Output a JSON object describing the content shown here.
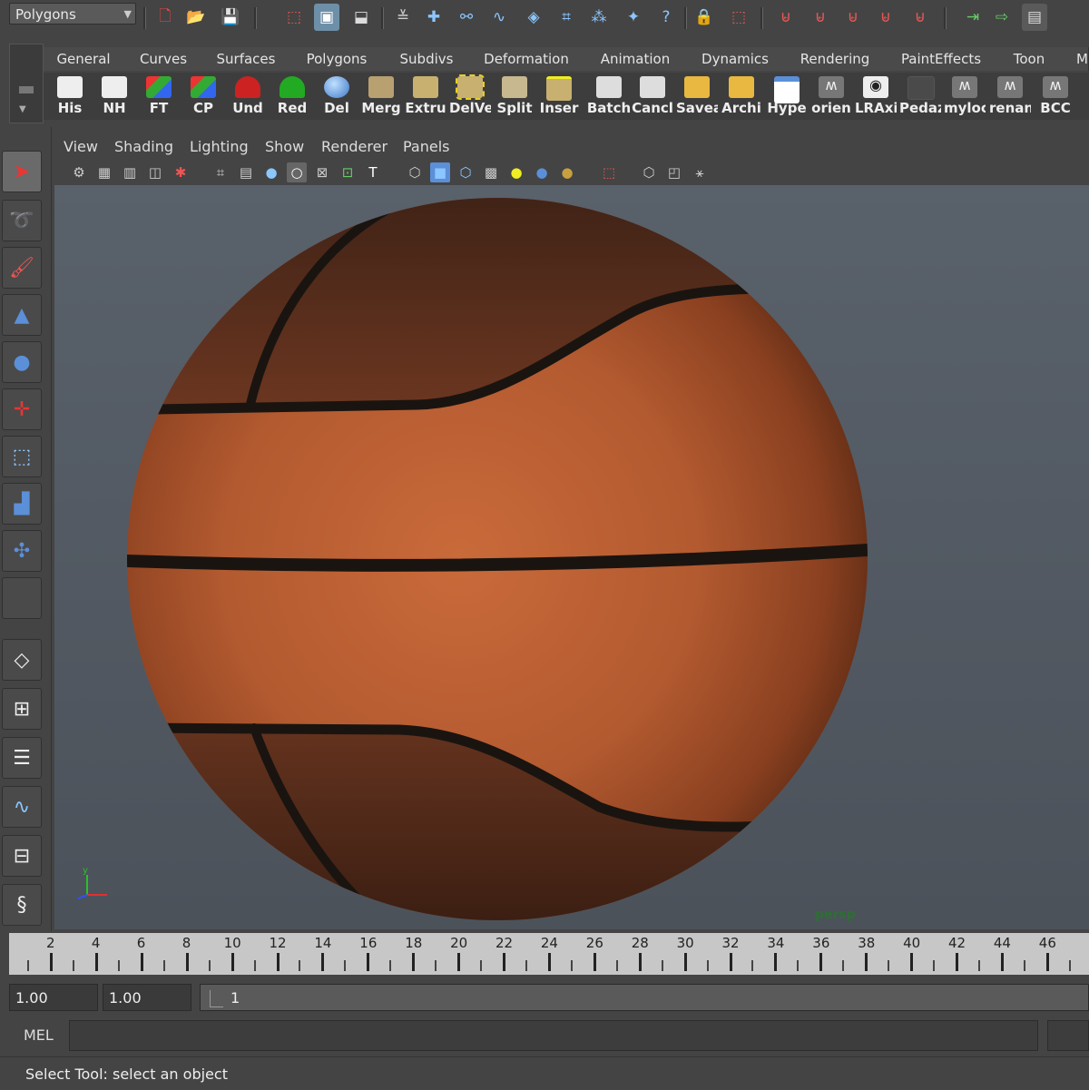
{
  "status_line": {
    "mode_selector": "Polygons",
    "icons": [
      "new-scene-icon",
      "open-scene-icon",
      "save-scene-icon",
      "select-by-hierarchy-icon",
      "select-by-object-icon",
      "select-by-component-icon",
      "mask-icon",
      "snap-grid-icon",
      "snap-curve-icon",
      "snap-point-icon",
      "snap-view-plane-icon",
      "make-live-icon",
      "history-icon",
      "snap-pivot-icon",
      "help-icon",
      "lock-icon",
      "selection-mask-icon",
      "magnet-icon",
      "magnet-icon",
      "magnet-icon",
      "magnet-icon",
      "magnet-icon",
      "render-icon",
      "ipr-render-icon",
      "attribute-editor-icon"
    ]
  },
  "shelf": {
    "tabs": [
      "General",
      "Curves",
      "Surfaces",
      "Polygons",
      "Subdivs",
      "Deformation",
      "Animation",
      "Dynamics",
      "Rendering",
      "PaintEffects",
      "Toon",
      "M"
    ],
    "buttons": [
      {
        "label": "His",
        "icon": "pencil-icon"
      },
      {
        "label": "NH",
        "icon": "pencil-icon"
      },
      {
        "label": "FT",
        "icon": "axes-icon"
      },
      {
        "label": "CP",
        "icon": "axes-icon"
      },
      {
        "label": "Und",
        "icon": "undo-icon"
      },
      {
        "label": "Red",
        "icon": "redo-icon"
      },
      {
        "label": "Del",
        "icon": "sphere-icon"
      },
      {
        "label": "Merg",
        "icon": "merge-icon"
      },
      {
        "label": "Extru",
        "icon": "extrude-icon"
      },
      {
        "label": "DelVe",
        "icon": "delete-vertex-icon"
      },
      {
        "label": "Split",
        "icon": "split-icon"
      },
      {
        "label": "Inser",
        "icon": "insert-edge-icon"
      },
      {
        "label": "Batch",
        "icon": "clapboard-icon"
      },
      {
        "label": "Cancl",
        "icon": "clapboard-icon"
      },
      {
        "label": "Savea",
        "icon": "folder-icon"
      },
      {
        "label": "Archi",
        "icon": "folder-icon"
      },
      {
        "label": "Hype",
        "icon": "window-icon"
      },
      {
        "label": "orien",
        "icon": "mel-script-icon"
      },
      {
        "label": "LRAxi",
        "icon": "eye-icon"
      },
      {
        "label": "Pedaz",
        "icon": "blank-icon"
      },
      {
        "label": "myloc",
        "icon": "mel-script-icon"
      },
      {
        "label": "renan",
        "icon": "mel-script-icon"
      },
      {
        "label": "BCC",
        "icon": "mel-script-icon"
      }
    ]
  },
  "panel": {
    "menus": [
      "View",
      "Shading",
      "Lighting",
      "Show",
      "Renderer",
      "Panels"
    ],
    "camera_label": "persp"
  },
  "time_slider": {
    "ticks": [
      "2",
      "4",
      "6",
      "8",
      "10",
      "12",
      "14",
      "16",
      "18",
      "20",
      "22",
      "24",
      "26",
      "28",
      "30",
      "32",
      "34",
      "36",
      "38",
      "40",
      "42",
      "44",
      "46"
    ]
  },
  "range_slider": {
    "start_time": "1.00",
    "current_start": "1.00",
    "range_value": "1"
  },
  "command_line": {
    "label": "MEL"
  },
  "help_line": {
    "text": "Select Tool: select an object"
  },
  "colors": {
    "ball_orange": "#b85f33",
    "ball_dark": "#5e3020",
    "seam": "#1a1410",
    "viewport_bg": "#555c64"
  }
}
